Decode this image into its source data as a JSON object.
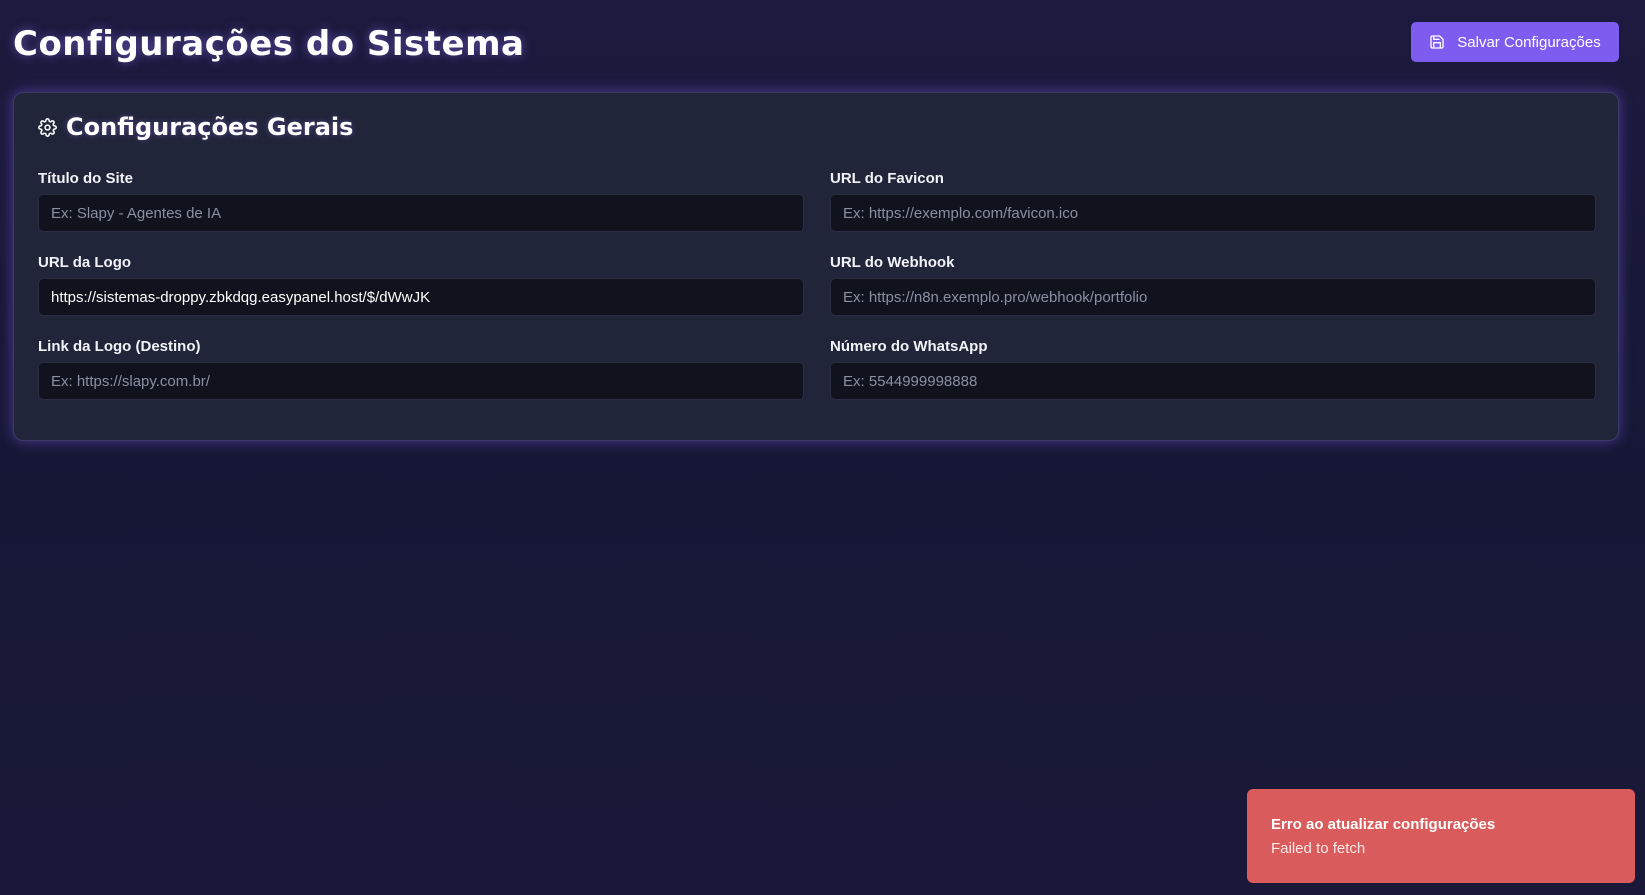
{
  "header": {
    "title": "Configurações do Sistema",
    "save_label": "Salvar Configurações",
    "save_icon": "save-icon"
  },
  "general": {
    "icon": "gear-icon",
    "title": "Configurações Gerais",
    "fields": {
      "site_title": {
        "label": "Título do Site",
        "value": "",
        "placeholder": "Ex: Slapy - Agentes de IA"
      },
      "favicon_url": {
        "label": "URL do Favicon",
        "value": "",
        "placeholder": "Ex: https://exemplo.com/favicon.ico"
      },
      "logo_url": {
        "label": "URL da Logo",
        "value": "https://sistemas-droppy.zbkdqg.easypanel.host/$/dWwJK",
        "placeholder": ""
      },
      "webhook_url": {
        "label": "URL do Webhook",
        "value": "",
        "placeholder": "Ex: https://n8n.exemplo.pro/webhook/portfolio"
      },
      "logo_link": {
        "label": "Link da Logo (Destino)",
        "value": "",
        "placeholder": "Ex: https://slapy.com.br/"
      },
      "whatsapp": {
        "label": "Número do WhatsApp",
        "value": "",
        "placeholder": "Ex: 5544999998888"
      }
    }
  },
  "toast": {
    "title": "Erro ao atualizar configurações",
    "message": "Failed to fetch"
  },
  "colors": {
    "accent": "#7e5cf0",
    "background": "#1a1838",
    "card": "#212539",
    "input": "#10131e",
    "error": "#d95b5b"
  }
}
